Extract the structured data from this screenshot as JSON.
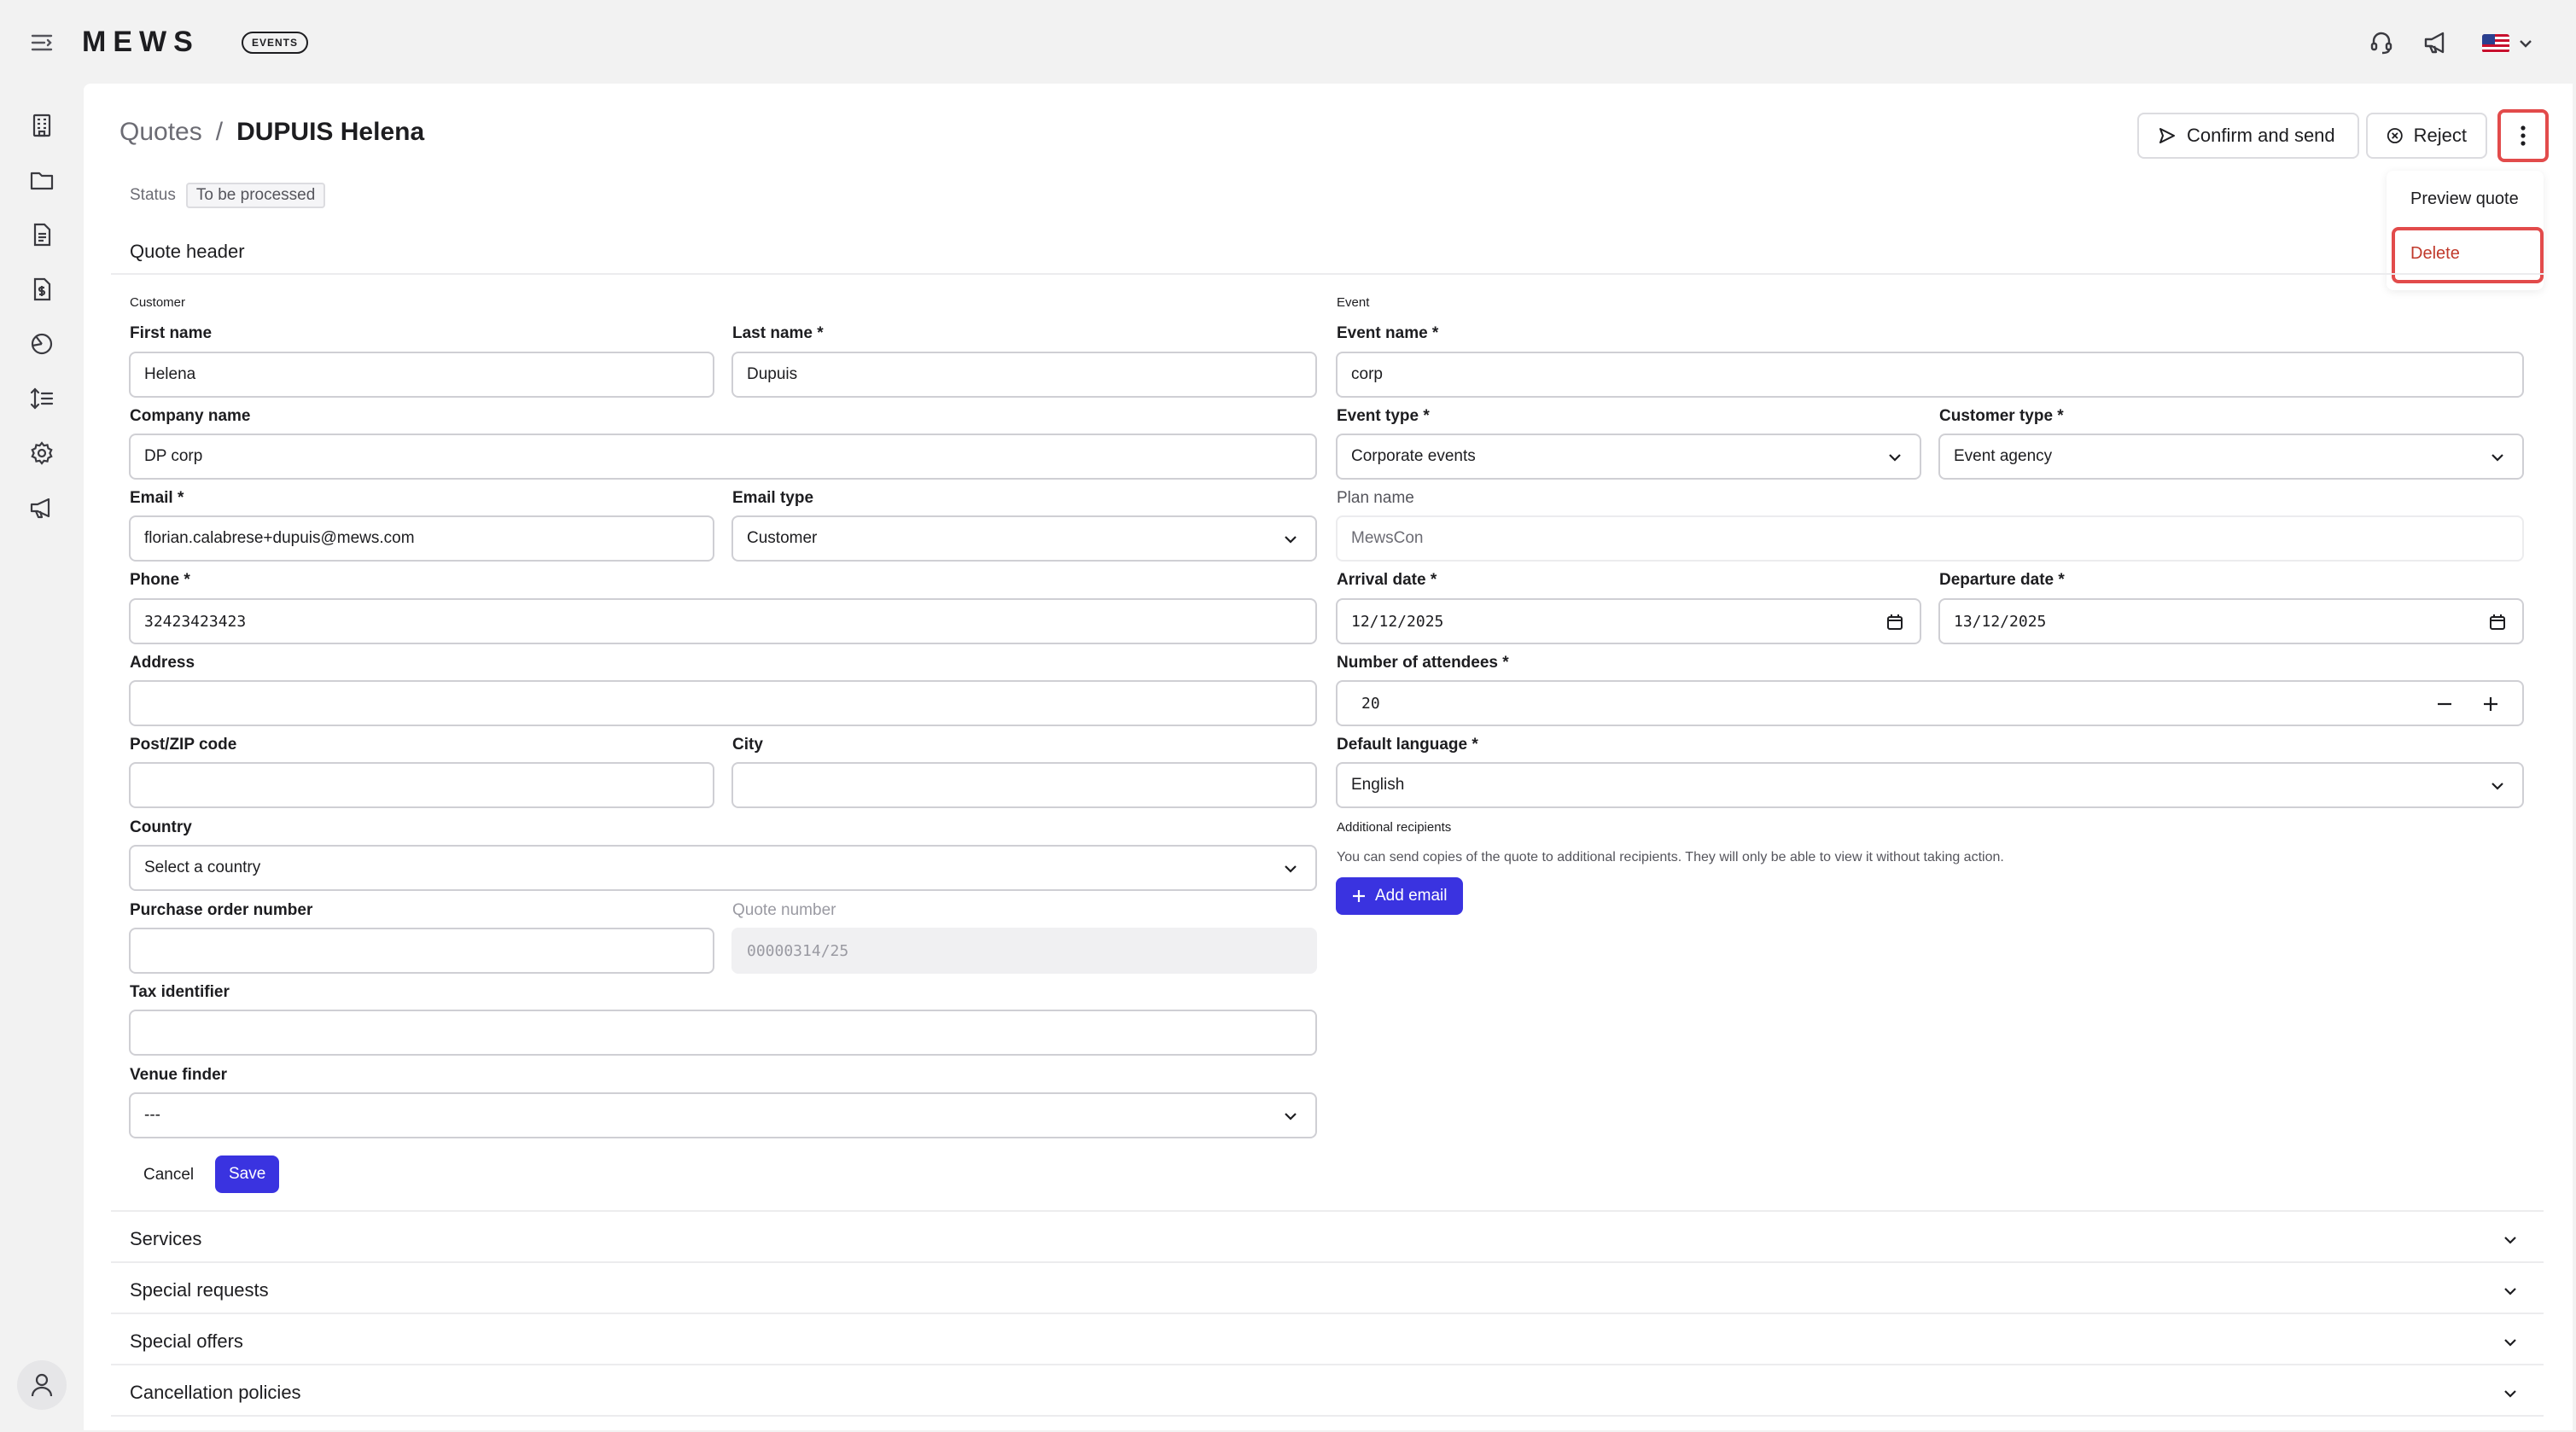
{
  "app": {
    "logo": "MEWS",
    "badge": "EVENTS"
  },
  "breadcrumb": {
    "parent": "Quotes",
    "separator": "/",
    "current": "DUPUIS Helena"
  },
  "actions": {
    "confirm_send": "Confirm and send",
    "reject": "Reject"
  },
  "menu": {
    "preview": "Preview quote",
    "delete": "Delete"
  },
  "status": {
    "label": "Status",
    "value": "To be processed"
  },
  "quote_header": {
    "title": "Quote header",
    "customer_group": "Customer",
    "event_group": "Event",
    "first_name": {
      "label": "First name",
      "value": "Helena"
    },
    "last_name": {
      "label": "Last name *",
      "value": "Dupuis"
    },
    "company": {
      "label": "Company name",
      "value": "DP corp"
    },
    "email": {
      "label": "Email *",
      "value": "florian.calabrese+dupuis@mews.com"
    },
    "email_type": {
      "label": "Email type",
      "value": "Customer"
    },
    "phone": {
      "label": "Phone *",
      "value": "32423423423"
    },
    "address": {
      "label": "Address",
      "value": ""
    },
    "postcode": {
      "label": "Post/ZIP code",
      "value": ""
    },
    "city": {
      "label": "City",
      "value": ""
    },
    "country": {
      "label": "Country",
      "value": "Select a country"
    },
    "po_number": {
      "label": "Purchase order number",
      "value": ""
    },
    "quote_number": {
      "label": "Quote number",
      "value": "00000314/25"
    },
    "tax_id": {
      "label": "Tax identifier",
      "value": ""
    },
    "venue_finder": {
      "label": "Venue finder",
      "value": "---"
    },
    "event_name": {
      "label": "Event name *",
      "value": "corp"
    },
    "event_type": {
      "label": "Event type *",
      "value": "Corporate events"
    },
    "customer_type": {
      "label": "Customer type *",
      "value": "Event agency"
    },
    "plan_name": {
      "label": "Plan name",
      "value": "MewsCon"
    },
    "arrival": {
      "label": "Arrival date *",
      "value": "12/12/2025"
    },
    "departure": {
      "label": "Departure date *",
      "value": "13/12/2025"
    },
    "attendees": {
      "label": "Number of attendees *",
      "value": "20"
    },
    "language": {
      "label": "Default language *",
      "value": "English"
    },
    "recipients": {
      "label": "Additional recipients",
      "help": "You can send copies of the quote to additional recipients. They will only be able to view it without taking action.",
      "add_button": "Add email"
    },
    "cancel": "Cancel",
    "save": "Save"
  },
  "sections": [
    "Services",
    "Special requests",
    "Special offers",
    "Cancellation policies"
  ],
  "colors": {
    "primary": "#3a33e0",
    "highlight": "#e24b4b"
  }
}
